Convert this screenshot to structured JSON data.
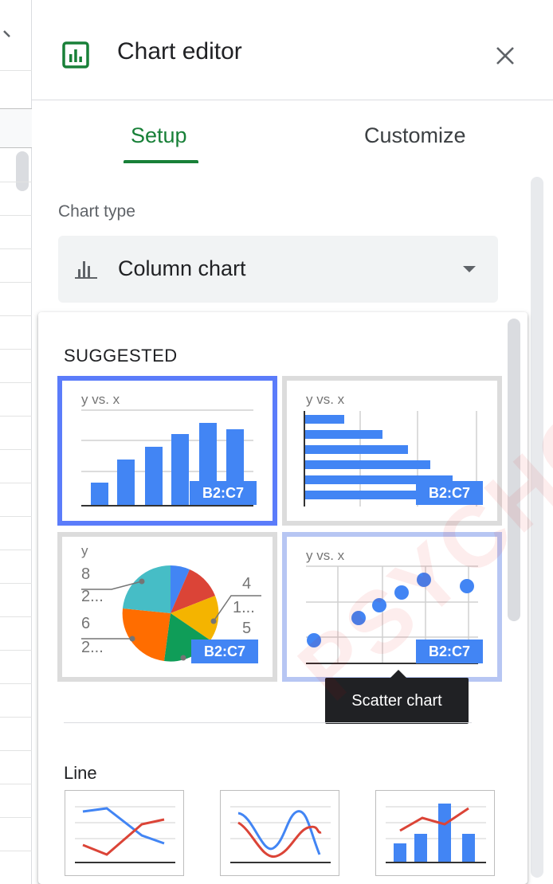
{
  "header": {
    "title": "Chart editor"
  },
  "tabs": [
    {
      "label": "Setup",
      "active": true
    },
    {
      "label": "Customize",
      "active": false
    }
  ],
  "chart_type": {
    "label": "Chart type",
    "selected": "Column chart"
  },
  "dropdown": {
    "suggested_title": "SUGGESTED",
    "thumbnails": [
      {
        "id": "column",
        "caption": "y vs. x",
        "range": "B2:C7",
        "selected": true
      },
      {
        "id": "bar",
        "caption": "y vs. x",
        "range": "B2:C7",
        "selected": false
      },
      {
        "id": "pie",
        "caption": "y",
        "range": "B2:C7",
        "selected": false,
        "labels": {
          "l1": "8",
          "l2": "2...",
          "l3": "6",
          "l4": "2...",
          "r1": "4",
          "r2": "1...",
          "r3": "5"
        }
      },
      {
        "id": "scatter",
        "caption": "y vs. x",
        "range": "B2:C7",
        "selected": false,
        "hovered": true
      }
    ],
    "tooltip": "Scatter chart",
    "line_section_title": "Line"
  },
  "colors": {
    "accent": "#188038",
    "blue": "#4285f4",
    "red": "#db4437",
    "yellow": "#f4b400",
    "green": "#0f9d58",
    "orange": "#ff6d00",
    "teal": "#46bdc6",
    "selected_border": "#5b7cfa"
  },
  "watermark": "PSYCHO"
}
